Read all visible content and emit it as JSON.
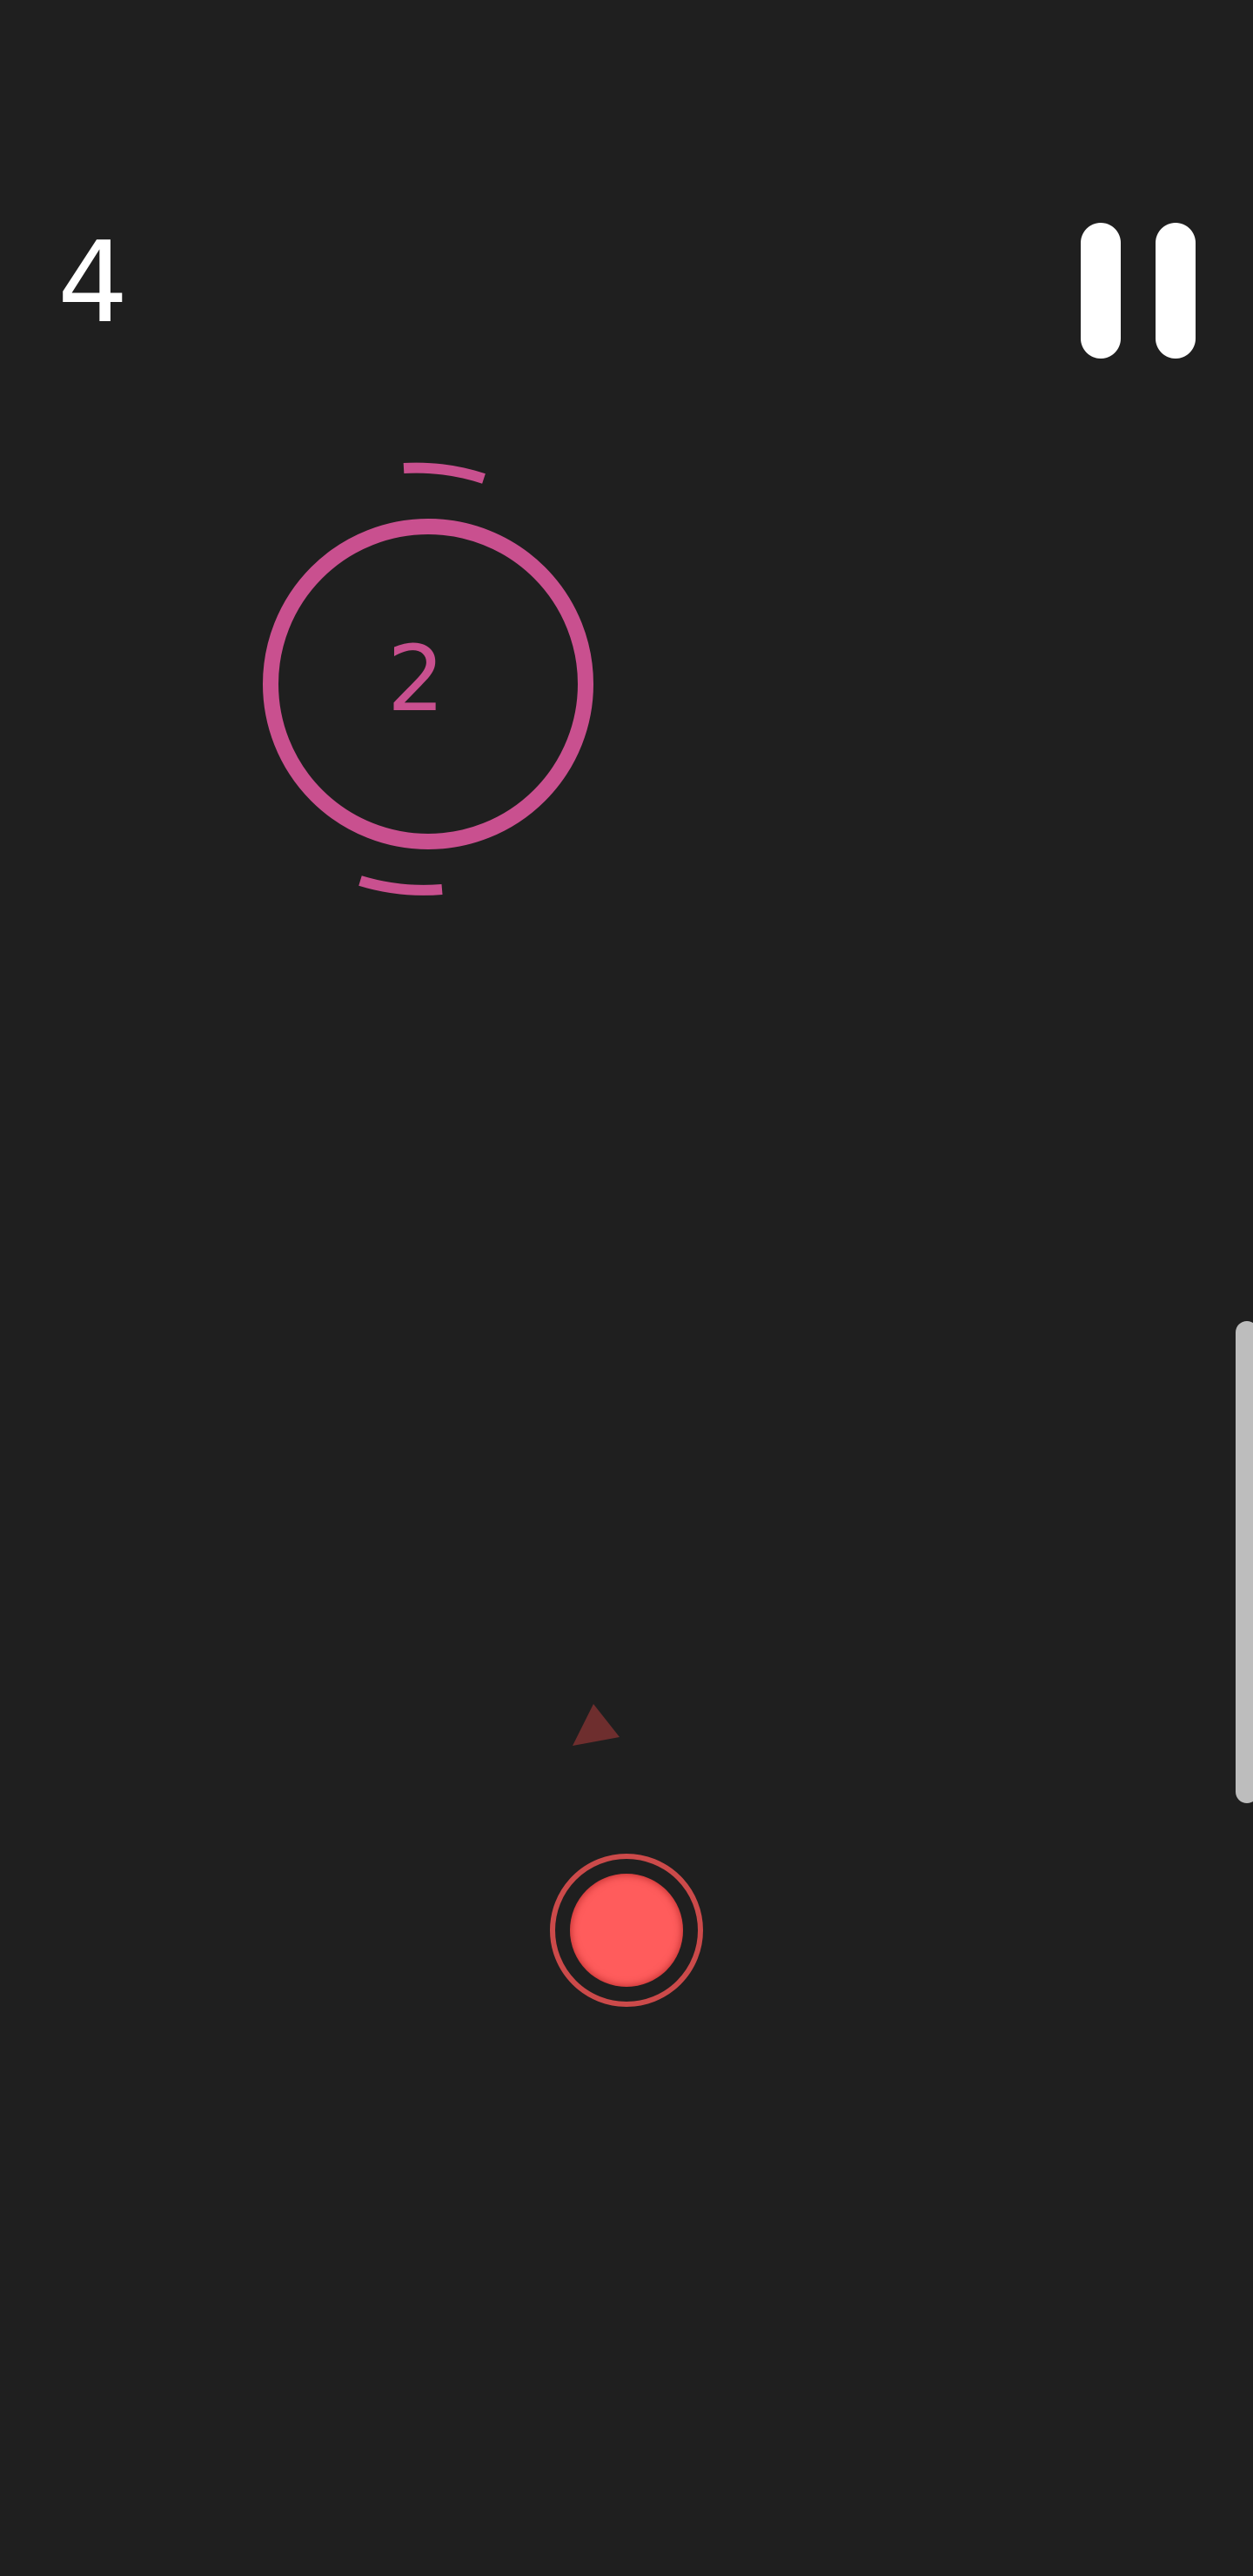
{
  "hud": {
    "score": "4",
    "pause_icon": "pause-icon"
  },
  "target": {
    "number": "2",
    "color": "#c9508f"
  },
  "player": {
    "ring_color": "#cc4a4a",
    "core_color": "#ff5c5c"
  },
  "aim_indicator": {
    "icon": "triangle-arrow-icon",
    "color": "#6e2e2e"
  },
  "colors": {
    "background": "#1f1f1f",
    "text": "#ffffff",
    "scroll_handle": "#bdbdbd"
  }
}
